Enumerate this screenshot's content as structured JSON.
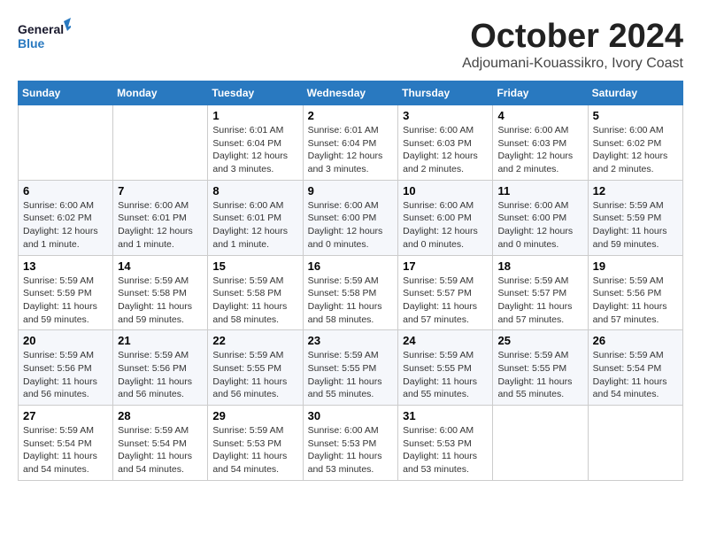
{
  "header": {
    "logo_general": "General",
    "logo_blue": "Blue",
    "month": "October 2024",
    "location": "Adjoumani-Kouassikro, Ivory Coast"
  },
  "days_of_week": [
    "Sunday",
    "Monday",
    "Tuesday",
    "Wednesday",
    "Thursday",
    "Friday",
    "Saturday"
  ],
  "weeks": [
    [
      {
        "day": "",
        "info": ""
      },
      {
        "day": "",
        "info": ""
      },
      {
        "day": "1",
        "info": "Sunrise: 6:01 AM\nSunset: 6:04 PM\nDaylight: 12 hours\nand 3 minutes."
      },
      {
        "day": "2",
        "info": "Sunrise: 6:01 AM\nSunset: 6:04 PM\nDaylight: 12 hours\nand 3 minutes."
      },
      {
        "day": "3",
        "info": "Sunrise: 6:00 AM\nSunset: 6:03 PM\nDaylight: 12 hours\nand 2 minutes."
      },
      {
        "day": "4",
        "info": "Sunrise: 6:00 AM\nSunset: 6:03 PM\nDaylight: 12 hours\nand 2 minutes."
      },
      {
        "day": "5",
        "info": "Sunrise: 6:00 AM\nSunset: 6:02 PM\nDaylight: 12 hours\nand 2 minutes."
      }
    ],
    [
      {
        "day": "6",
        "info": "Sunrise: 6:00 AM\nSunset: 6:02 PM\nDaylight: 12 hours\nand 1 minute."
      },
      {
        "day": "7",
        "info": "Sunrise: 6:00 AM\nSunset: 6:01 PM\nDaylight: 12 hours\nand 1 minute."
      },
      {
        "day": "8",
        "info": "Sunrise: 6:00 AM\nSunset: 6:01 PM\nDaylight: 12 hours\nand 1 minute."
      },
      {
        "day": "9",
        "info": "Sunrise: 6:00 AM\nSunset: 6:00 PM\nDaylight: 12 hours\nand 0 minutes."
      },
      {
        "day": "10",
        "info": "Sunrise: 6:00 AM\nSunset: 6:00 PM\nDaylight: 12 hours\nand 0 minutes."
      },
      {
        "day": "11",
        "info": "Sunrise: 6:00 AM\nSunset: 6:00 PM\nDaylight: 12 hours\nand 0 minutes."
      },
      {
        "day": "12",
        "info": "Sunrise: 5:59 AM\nSunset: 5:59 PM\nDaylight: 11 hours\nand 59 minutes."
      }
    ],
    [
      {
        "day": "13",
        "info": "Sunrise: 5:59 AM\nSunset: 5:59 PM\nDaylight: 11 hours\nand 59 minutes."
      },
      {
        "day": "14",
        "info": "Sunrise: 5:59 AM\nSunset: 5:58 PM\nDaylight: 11 hours\nand 59 minutes."
      },
      {
        "day": "15",
        "info": "Sunrise: 5:59 AM\nSunset: 5:58 PM\nDaylight: 11 hours\nand 58 minutes."
      },
      {
        "day": "16",
        "info": "Sunrise: 5:59 AM\nSunset: 5:58 PM\nDaylight: 11 hours\nand 58 minutes."
      },
      {
        "day": "17",
        "info": "Sunrise: 5:59 AM\nSunset: 5:57 PM\nDaylight: 11 hours\nand 57 minutes."
      },
      {
        "day": "18",
        "info": "Sunrise: 5:59 AM\nSunset: 5:57 PM\nDaylight: 11 hours\nand 57 minutes."
      },
      {
        "day": "19",
        "info": "Sunrise: 5:59 AM\nSunset: 5:56 PM\nDaylight: 11 hours\nand 57 minutes."
      }
    ],
    [
      {
        "day": "20",
        "info": "Sunrise: 5:59 AM\nSunset: 5:56 PM\nDaylight: 11 hours\nand 56 minutes."
      },
      {
        "day": "21",
        "info": "Sunrise: 5:59 AM\nSunset: 5:56 PM\nDaylight: 11 hours\nand 56 minutes."
      },
      {
        "day": "22",
        "info": "Sunrise: 5:59 AM\nSunset: 5:55 PM\nDaylight: 11 hours\nand 56 minutes."
      },
      {
        "day": "23",
        "info": "Sunrise: 5:59 AM\nSunset: 5:55 PM\nDaylight: 11 hours\nand 55 minutes."
      },
      {
        "day": "24",
        "info": "Sunrise: 5:59 AM\nSunset: 5:55 PM\nDaylight: 11 hours\nand 55 minutes."
      },
      {
        "day": "25",
        "info": "Sunrise: 5:59 AM\nSunset: 5:55 PM\nDaylight: 11 hours\nand 55 minutes."
      },
      {
        "day": "26",
        "info": "Sunrise: 5:59 AM\nSunset: 5:54 PM\nDaylight: 11 hours\nand 54 minutes."
      }
    ],
    [
      {
        "day": "27",
        "info": "Sunrise: 5:59 AM\nSunset: 5:54 PM\nDaylight: 11 hours\nand 54 minutes."
      },
      {
        "day": "28",
        "info": "Sunrise: 5:59 AM\nSunset: 5:54 PM\nDaylight: 11 hours\nand 54 minutes."
      },
      {
        "day": "29",
        "info": "Sunrise: 5:59 AM\nSunset: 5:53 PM\nDaylight: 11 hours\nand 54 minutes."
      },
      {
        "day": "30",
        "info": "Sunrise: 6:00 AM\nSunset: 5:53 PM\nDaylight: 11 hours\nand 53 minutes."
      },
      {
        "day": "31",
        "info": "Sunrise: 6:00 AM\nSunset: 5:53 PM\nDaylight: 11 hours\nand 53 minutes."
      },
      {
        "day": "",
        "info": ""
      },
      {
        "day": "",
        "info": ""
      }
    ]
  ]
}
